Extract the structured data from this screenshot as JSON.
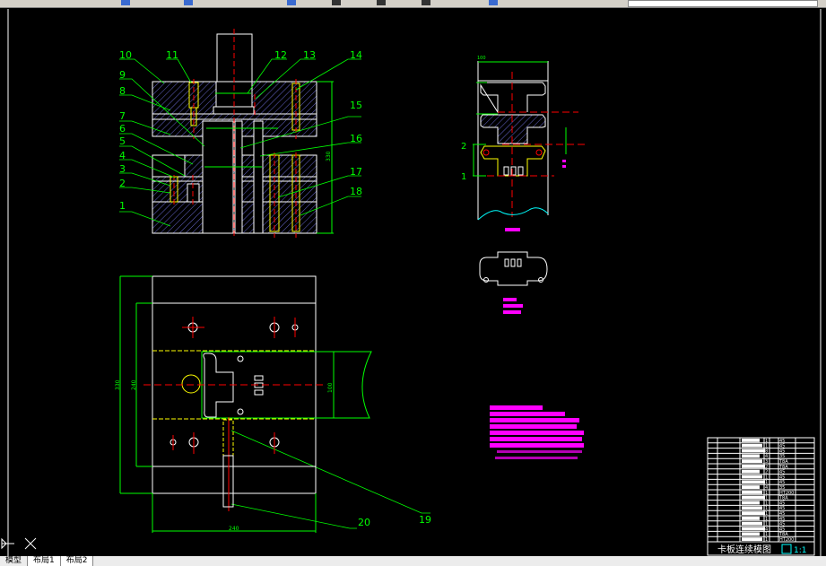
{
  "app": {
    "view": "model-space"
  },
  "colors": {
    "background": "#000000",
    "outline": "#ffffff",
    "dimension": "#00ff00",
    "centerline": "#ff0000",
    "hidden": "#ffff00",
    "hatch": "#8080ff",
    "annotation": "#ff00ff",
    "break_line": "#00ffff"
  },
  "tabs": [
    {
      "label": "模型",
      "active": true
    },
    {
      "label": "布局1",
      "active": false
    },
    {
      "label": "布局2",
      "active": false
    }
  ],
  "drawing": {
    "part_numbers": [
      "1",
      "2",
      "3",
      "4",
      "5",
      "6",
      "7",
      "8",
      "9",
      "10",
      "11",
      "12",
      "13",
      "14",
      "15",
      "16",
      "17",
      "18",
      "19",
      "20"
    ],
    "dimensions": {
      "height_section": "330",
      "plan_height_outer": "330",
      "plan_height_inner": "240",
      "plan_width": "240",
      "strip_width": "100",
      "strip_pitch": "100"
    },
    "title_block": {
      "title": "卡板连续模图",
      "scale": "1:1",
      "rows": [
        {
          "qty": "1",
          "material": "45"
        },
        {
          "qty": "1",
          "material": "45"
        },
        {
          "qty": "8",
          "material": "45"
        },
        {
          "qty": "4",
          "material": "35"
        },
        {
          "qty": "3",
          "material": "T8A"
        },
        {
          "qty": "2",
          "material": "T8A"
        },
        {
          "qty": "2",
          "material": "45"
        },
        {
          "qty": "1",
          "material": "45"
        },
        {
          "qty": "1",
          "material": "45"
        },
        {
          "qty": "4",
          "material": "35"
        },
        {
          "qty": "1",
          "material": "HT200"
        },
        {
          "qty": "1",
          "material": "T8A"
        },
        {
          "qty": "1",
          "material": "45"
        },
        {
          "qty": "1",
          "material": "45"
        },
        {
          "qty": "1",
          "material": "45"
        },
        {
          "qty": "1",
          "material": "45"
        },
        {
          "qty": "1",
          "material": "45"
        },
        {
          "qty": "4",
          "material": "45"
        },
        {
          "qty": "1",
          "material": "T8A"
        },
        {
          "qty": "1",
          "material": "HT200"
        }
      ]
    }
  }
}
